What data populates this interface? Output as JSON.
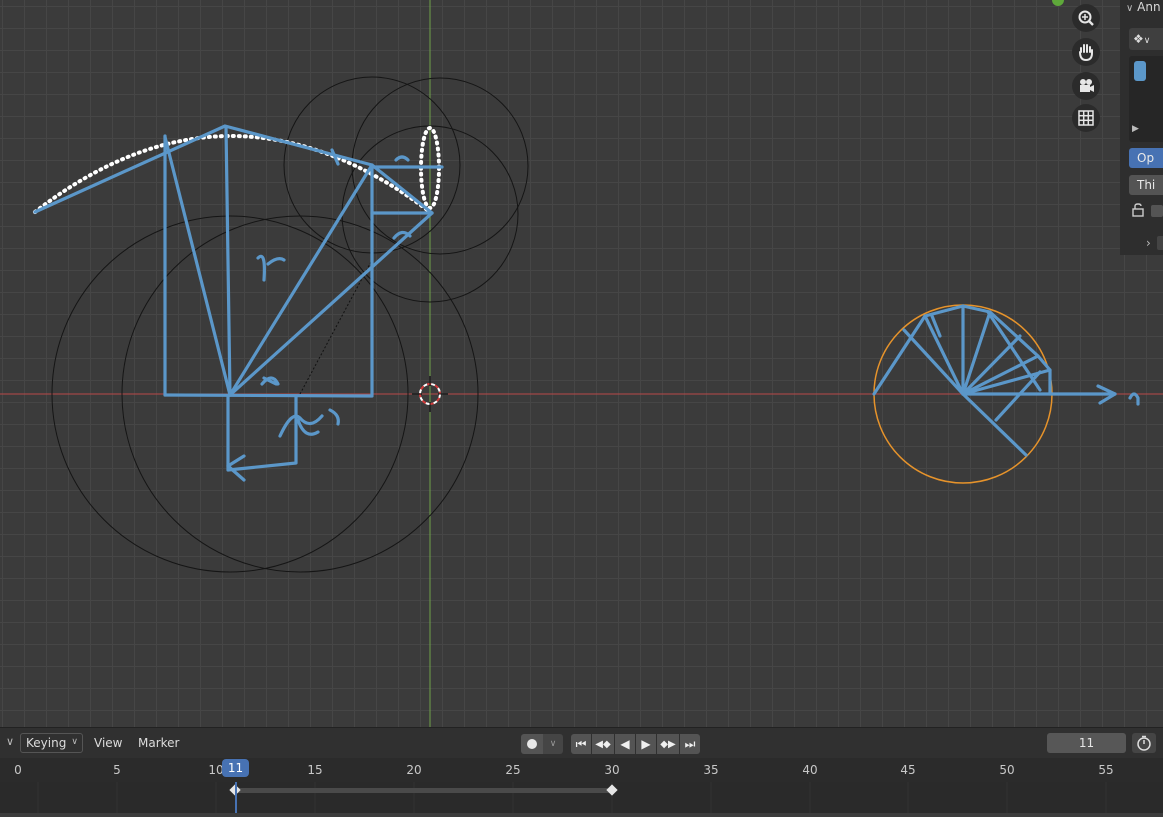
{
  "viewport": {
    "nav_icons": [
      "zoom-icon",
      "hand-pan-icon",
      "camera-icon",
      "grid-icon"
    ]
  },
  "side_panel": {
    "header": "Ann",
    "button_op": "Op",
    "button_thi": "Thi"
  },
  "timeline": {
    "menu_keying": "Keying",
    "menu_view": "View",
    "menu_marker": "Marker",
    "current_frame": "11",
    "frame_field": "11",
    "ruler_labels": [
      "0",
      "5",
      "10",
      "15",
      "20",
      "25",
      "30",
      "35",
      "40",
      "45",
      "50",
      "55"
    ]
  },
  "colors": {
    "accent": "#4772b3",
    "stroke_blue": "#5b97c9",
    "selection_orange": "#e6932b",
    "x_axis": "#b84848",
    "y_axis": "#6fa14a"
  }
}
